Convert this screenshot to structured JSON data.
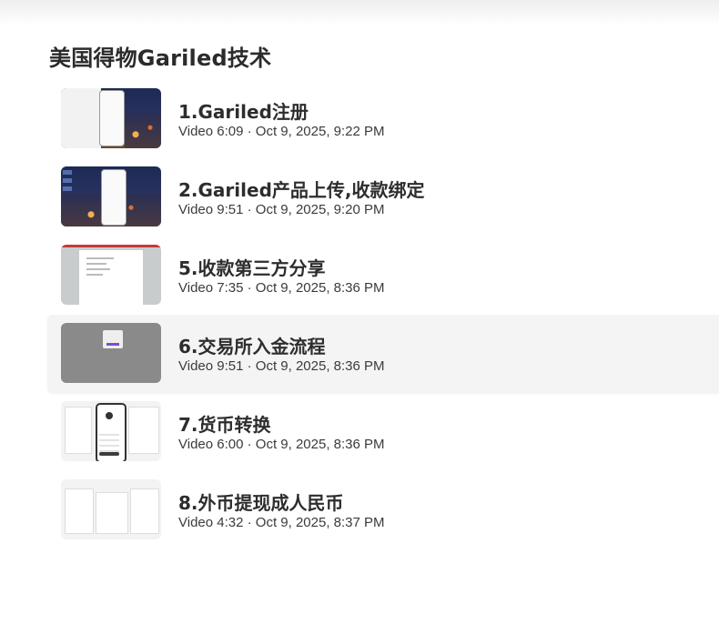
{
  "page": {
    "title": "美国得物Gariled技术"
  },
  "videos": [
    {
      "title": "1.Gariled注册",
      "meta": "Video 6:09 · Oct 9, 2025, 9:22 PM",
      "thumb": "desktop-screenshot"
    },
    {
      "title": "2.Gariled产品上传,收款绑定",
      "meta": "Video 9:51 · Oct 9, 2025, 9:20 PM",
      "thumb": "desktop-screenshot"
    },
    {
      "title": "5.收款第三方分享",
      "meta": "Video 7:35 · Oct 9, 2025, 8:36 PM",
      "thumb": "document-screenshot"
    },
    {
      "title": "6.交易所入金流程",
      "meta": "Video 9:51 · Oct 9, 2025, 8:36 PM",
      "thumb": "dimmed-web-screenshot"
    },
    {
      "title": "7.货币转换",
      "meta": "Video 6:00 · Oct 9, 2025, 8:36 PM",
      "thumb": "web-app-screenshot"
    },
    {
      "title": "8.外币提现成人民币",
      "meta": "Video 4:32 · Oct 9, 2025, 8:37 PM",
      "thumb": "web-app-screenshot"
    }
  ],
  "colors": {
    "active_row_bg": "#f4f4f4",
    "title_text": "#2b2b2b",
    "meta_text": "#3b3b3b"
  }
}
